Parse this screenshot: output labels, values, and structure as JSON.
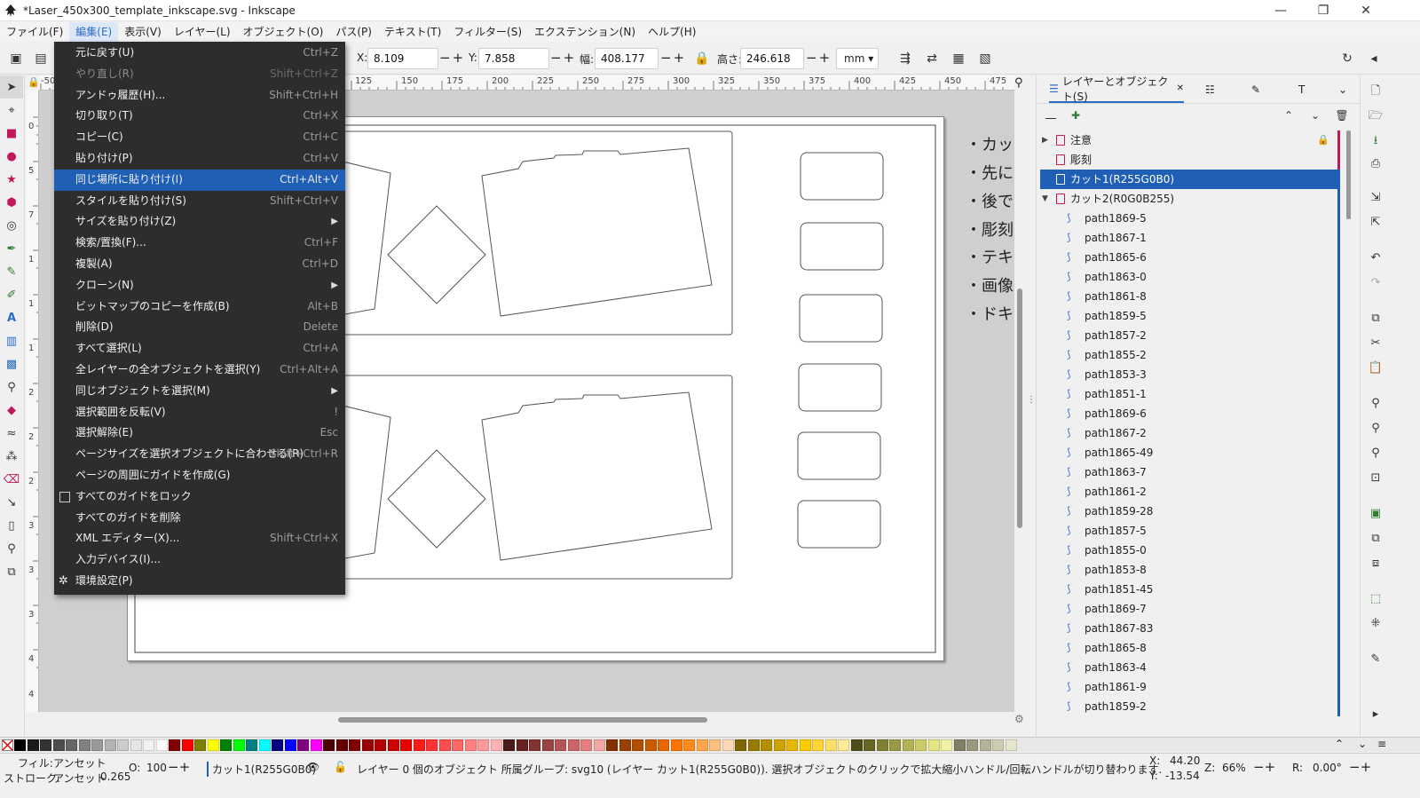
{
  "window": {
    "title": "*Laser_450x300_template_inkscape.svg - Inkscape",
    "minimize": "—",
    "restore": "❐",
    "close": "✕"
  },
  "menubar": [
    "ファイル(F)",
    "編集(E)",
    "表示(V)",
    "レイヤー(L)",
    "オブジェクト(O)",
    "パス(P)",
    "テキスト(T)",
    "フィルター(S)",
    "エクステンション(N)",
    "ヘルプ(H)"
  ],
  "toolctrl": {
    "x_label": "X:",
    "x_value": "8.109",
    "y_label": "Y:",
    "y_value": "7.858",
    "w_label": "幅:",
    "w_value": "408.177",
    "h_label": "高さ:",
    "h_value": "246.618",
    "unit": "mm",
    "plusminus": "−+"
  },
  "ruler": {
    "top_ticks": [
      "-50",
      "125",
      "150",
      "175",
      "200",
      "225",
      "250",
      "275",
      "300",
      "325",
      "350",
      "375",
      "400",
      "425",
      "450",
      "475"
    ],
    "left_ticks": [
      "0",
      "5",
      "7",
      "1",
      "1",
      "1",
      "2",
      "2",
      "2",
      "3",
      "3",
      "3",
      "4",
      "4"
    ]
  },
  "edit_menu": {
    "items": [
      {
        "label": "元に戻す(U)",
        "shortcut": "Ctrl+Z"
      },
      {
        "label": "やり直し(R)",
        "shortcut": "Shift+Ctrl+Z",
        "disabled": true
      },
      {
        "label": "アンドゥ履歴(H)...",
        "shortcut": "Shift+Ctrl+H"
      },
      {
        "label": "切り取り(T)",
        "shortcut": "Ctrl+X"
      },
      {
        "label": "コピー(C)",
        "shortcut": "Ctrl+C"
      },
      {
        "label": "貼り付け(P)",
        "shortcut": "Ctrl+V"
      },
      {
        "label": "同じ場所に貼り付け(I)",
        "shortcut": "Ctrl+Alt+V",
        "highlighted": true
      },
      {
        "label": "スタイルを貼り付け(S)",
        "shortcut": "Shift+Ctrl+V"
      },
      {
        "label": "サイズを貼り付け(Z)",
        "submenu": true
      },
      {
        "label": "検索/置換(F)...",
        "shortcut": "Ctrl+F"
      },
      {
        "label": "複製(A)",
        "shortcut": "Ctrl+D"
      },
      {
        "label": "クローン(N)",
        "submenu": true
      },
      {
        "label": "ビットマップのコピーを作成(B)",
        "shortcut": "Alt+B"
      },
      {
        "label": "削除(D)",
        "shortcut": "Delete"
      },
      {
        "label": "すべて選択(L)",
        "shortcut": "Ctrl+A"
      },
      {
        "label": "全レイヤーの全オブジェクトを選択(Y)",
        "shortcut": "Ctrl+Alt+A"
      },
      {
        "label": "同じオブジェクトを選択(M)",
        "submenu": true
      },
      {
        "label": "選択範囲を反転(V)",
        "shortcut": "!"
      },
      {
        "label": "選択解除(E)",
        "shortcut": "Esc"
      },
      {
        "label": "ページサイズを選択オブジェクトに合わせる(R)",
        "shortcut": "Shift+Ctrl+R"
      },
      {
        "label": "ページの周囲にガイドを作成(G)"
      },
      {
        "label": "すべてのガイドをロック",
        "checkbox": true
      },
      {
        "label": "すべてのガイドを削除"
      },
      {
        "label": "XML エディター(X)...",
        "shortcut": "Shift+Ctrl+X"
      },
      {
        "label": "入力デバイス(I)..."
      },
      {
        "label": "環境設定(P)",
        "icon": "preferences-icon"
      }
    ],
    "submenu_arrow": "▶"
  },
  "canvas_notes": [
    "・カット",
    "・先に",
    "・後で",
    "・彫刻",
    "・テキ",
    "・画像",
    "・ドキ"
  ],
  "dock": {
    "tab_label": "レイヤーとオブジェクト(S)",
    "tab_close": "✕",
    "layers": [
      {
        "name": "注意",
        "kind": "layer",
        "expander": "▶",
        "locked": true,
        "bar": "#c2185b"
      },
      {
        "name": "彫刻",
        "kind": "layer",
        "bar": "#c2185b"
      },
      {
        "name": "カット1(R255G0B0)",
        "kind": "layer",
        "selected": true,
        "bar": "#1f5fb5"
      },
      {
        "name": "カット2(R0G0B255)",
        "kind": "layer",
        "expander": "▼",
        "bar": "#1f5fb5"
      },
      {
        "name": "path1869-5",
        "kind": "path"
      },
      {
        "name": "path1867-1",
        "kind": "path"
      },
      {
        "name": "path1865-6",
        "kind": "path"
      },
      {
        "name": "path1863-0",
        "kind": "path"
      },
      {
        "name": "path1861-8",
        "kind": "path"
      },
      {
        "name": "path1859-5",
        "kind": "path"
      },
      {
        "name": "path1857-2",
        "kind": "path"
      },
      {
        "name": "path1855-2",
        "kind": "path"
      },
      {
        "name": "path1853-3",
        "kind": "path"
      },
      {
        "name": "path1851-1",
        "kind": "path"
      },
      {
        "name": "path1869-6",
        "kind": "path"
      },
      {
        "name": "path1867-2",
        "kind": "path"
      },
      {
        "name": "path1865-49",
        "kind": "path"
      },
      {
        "name": "path1863-7",
        "kind": "path"
      },
      {
        "name": "path1861-2",
        "kind": "path"
      },
      {
        "name": "path1859-28",
        "kind": "path"
      },
      {
        "name": "path1857-5",
        "kind": "path"
      },
      {
        "name": "path1855-0",
        "kind": "path"
      },
      {
        "name": "path1853-8",
        "kind": "path"
      },
      {
        "name": "path1851-45",
        "kind": "path"
      },
      {
        "name": "path1869-7",
        "kind": "path"
      },
      {
        "name": "path1867-83",
        "kind": "path"
      },
      {
        "name": "path1865-8",
        "kind": "path"
      },
      {
        "name": "path1863-4",
        "kind": "path"
      },
      {
        "name": "path1861-9",
        "kind": "path"
      },
      {
        "name": "path1859-2",
        "kind": "path"
      }
    ]
  },
  "palette": {
    "colors": [
      "#000000",
      "#1a1a1a",
      "#333333",
      "#4d4d4d",
      "#666666",
      "#808080",
      "#999999",
      "#b3b3b3",
      "#cccccc",
      "#e6e6e6",
      "#f2f2f2",
      "#ffffff",
      "#800000",
      "#ff0000",
      "#808000",
      "#ffff00",
      "#008000",
      "#00ff00",
      "#008080",
      "#00ffff",
      "#000080",
      "#0000ff",
      "#800080",
      "#ff00ff",
      "#4d0000",
      "#660000",
      "#800000",
      "#990000",
      "#b30000",
      "#cc0000",
      "#e60000",
      "#ff1a1a",
      "#ff3333",
      "#ff4d4d",
      "#ff6666",
      "#ff8080",
      "#ff9999",
      "#ffb3b3",
      "#4d1a1a",
      "#662222",
      "#803333",
      "#994444",
      "#b35555",
      "#cc6666",
      "#e68080",
      "#f2a6a6",
      "#803300",
      "#994000",
      "#b34d00",
      "#cc5a00",
      "#e66600",
      "#ff7300",
      "#ff8c1a",
      "#ffa64d",
      "#ffbf80",
      "#ffd9b3",
      "#806600",
      "#997a00",
      "#b38f00",
      "#cca300",
      "#e6b800",
      "#ffcc00",
      "#ffd633",
      "#ffe066",
      "#ffeb99",
      "#4d4d1a",
      "#666622",
      "#808033",
      "#999944",
      "#b3b355",
      "#cccc66",
      "#e6e680",
      "#f2f2a6",
      "#808066",
      "#999980",
      "#b3b399",
      "#ccccb3",
      "#e6e6cc"
    ]
  },
  "status": {
    "fill_label": "フィル:",
    "fill_value": "アンセット",
    "stroke_label": "ストローク:",
    "stroke_value": "アンセット",
    "stroke_width": "0.265",
    "opacity_label": "O:",
    "opacity_value": "100",
    "layer_name": "カット1(R255G0B0)",
    "message": "レイヤー 0 個のオブジェクト 所属グループ: svg10 (レイヤー カット1(R255G0B0)). 選択オブジェクトのクリックで拡大縮小ハンドル/回転ハンドルが切り替わります.",
    "x_label": "X:",
    "x_value": "44.20",
    "y_label": "Y:",
    "y_value": "-13.54",
    "zoom_label": "Z:",
    "zoom_value": "66%",
    "rotate_label": "R:",
    "rotate_value": "0.00°"
  }
}
